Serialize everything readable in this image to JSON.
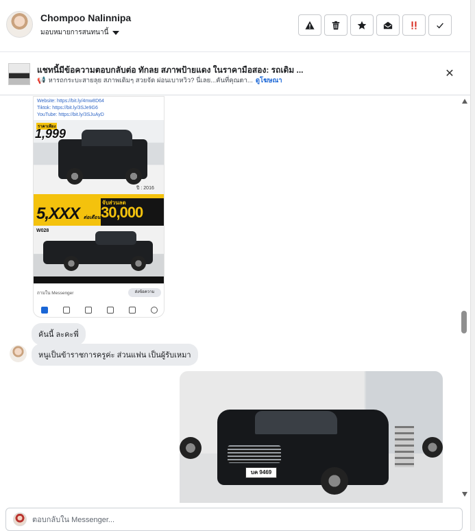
{
  "header": {
    "contact_name": "Chompoo Nalinnipa",
    "assign_label": "มอบหมายการสนทนานี้",
    "actions": [
      {
        "icon": "warning-icon"
      },
      {
        "icon": "trash-icon"
      },
      {
        "icon": "star-icon"
      },
      {
        "icon": "open-envelope-icon"
      },
      {
        "icon": "double-exclamation-icon",
        "color": "#d93025"
      },
      {
        "icon": "checkmark-icon"
      }
    ]
  },
  "banner": {
    "title": "แชทนี้มีข้อความตอบกลับต่อ ทักลย สภาพป้ายแดง ในราคามือสอง: รถเดิม ...",
    "subtitle": "หารถกระบะสายลุย สภาพเดิมๆ สวยจัด ผ่อนเบาหวิว? นี่เลย...คันที่คุณตา...",
    "ad_link": "ดูโฆษณา"
  },
  "poster": {
    "links": [
      "Website: https://bit.ly/4mw8D64",
      "Tiktok: https://bit.ly/3SJe9G6",
      "YouTube: https://bit.ly/3SJuAyD"
    ],
    "price_label": "ราคาเพียง",
    "price": "1,999",
    "year": "ปี : 2016",
    "monthly": "5,XXX",
    "monthly_unit": "ต่อเดือน",
    "discount_label": "จับส่วนลด",
    "discount": "30,000",
    "code": "W028",
    "msg_left": "ถามใน Messenger",
    "msg_right": "ส่งข้อความ"
  },
  "messages": [
    {
      "text": "คันนี้ ละคะพี่"
    },
    {
      "text": "หนูเป็นข้าราชการครูค่ะ ส่วนแฟน เป็นผู้รับเหมา"
    }
  ],
  "sent_image": {
    "plate": "บค 9469"
  },
  "composer": {
    "placeholder": "ตอบกลับใน Messenger..."
  }
}
